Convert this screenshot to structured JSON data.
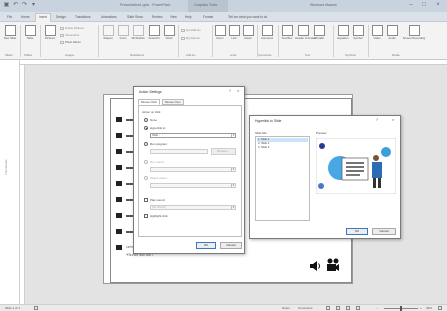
{
  "titlebar": {
    "title": "Presentation1.pptx - PowerPoint",
    "context_tab": "Graphics Tools",
    "user": "Windows Maanto"
  },
  "tabs": [
    "File",
    "Home",
    "Insert",
    "Design",
    "Transitions",
    "Animations",
    "Slide Show",
    "Review",
    "View",
    "Help",
    "Format",
    "Tell me what you want to do"
  ],
  "active_tab": "Insert",
  "ribbon": {
    "slides": {
      "new_slide": "New Slide",
      "group": "Slides"
    },
    "tables": {
      "table": "Table",
      "group": "Tables"
    },
    "images": {
      "pictures": "Pictures",
      "online_pictures": "Online Pictures",
      "screenshot": "Screenshot",
      "photo_album": "Photo Album",
      "group": "Images"
    },
    "illustrations": {
      "shapes": "Shapes",
      "icons": "Icons",
      "models": "3D Models",
      "smartart": "SmartArt",
      "chart": "Chart",
      "group": "Illustrations"
    },
    "addins": {
      "get": "Get Add-ins",
      "my": "My Add-ins",
      "group": "Add-ins"
    },
    "links": {
      "zoom": "Zoom",
      "link": "Link",
      "action": "Action",
      "group": "Links"
    },
    "comments": {
      "comment": "Comment",
      "group": "Comments"
    },
    "text": {
      "textbox": "Text Box",
      "header": "Header & Footer",
      "wordart": "WordArt",
      "group": "Text"
    },
    "symbols": {
      "equation": "Equation",
      "symbol": "Symbol",
      "group": "Symbols"
    },
    "media": {
      "video": "Video",
      "audio": "Audio",
      "screen_recording": "Screen Recording",
      "group": "Media"
    }
  },
  "thumb_pane": {
    "label": "Thumbnails"
  },
  "slide": {
    "footer_line_1": "কোন স্লাইড শো শুরু করার পর স্লাইড বা অবজেক্টে ক্লিক করলে",
    "footer_line_2": "পরিবর্তন করা যায় ।"
  },
  "action_settings": {
    "title": "Action Settings",
    "tabs": [
      "Mouse Click",
      "Mouse Over"
    ],
    "section": "Action on click",
    "none": "None",
    "hyperlink": "Hyperlink to:",
    "hyperlink_value": "Slide...",
    "run_program": "Run program:",
    "browse": "Browse...",
    "run_macro": "Run macro:",
    "object_action": "Object action:",
    "play_sound": "Play sound:",
    "sound_value": "[No Sound]",
    "highlight": "Highlight click",
    "ok": "OK",
    "cancel": "Cancel"
  },
  "hyperlink_dialog": {
    "title": "Hyperlink to Slide",
    "slide_title_label": "Slide title:",
    "slides": [
      "1. Slide 1",
      "2. Slide 2",
      "3. Slide 3"
    ],
    "preview_label": "Preview",
    "ok": "OK",
    "cancel": "Cancel"
  },
  "statusbar": {
    "slide_info": "Slide 1 of 1",
    "notes": "Notes",
    "comments": "Comments",
    "zoom": "49%"
  }
}
